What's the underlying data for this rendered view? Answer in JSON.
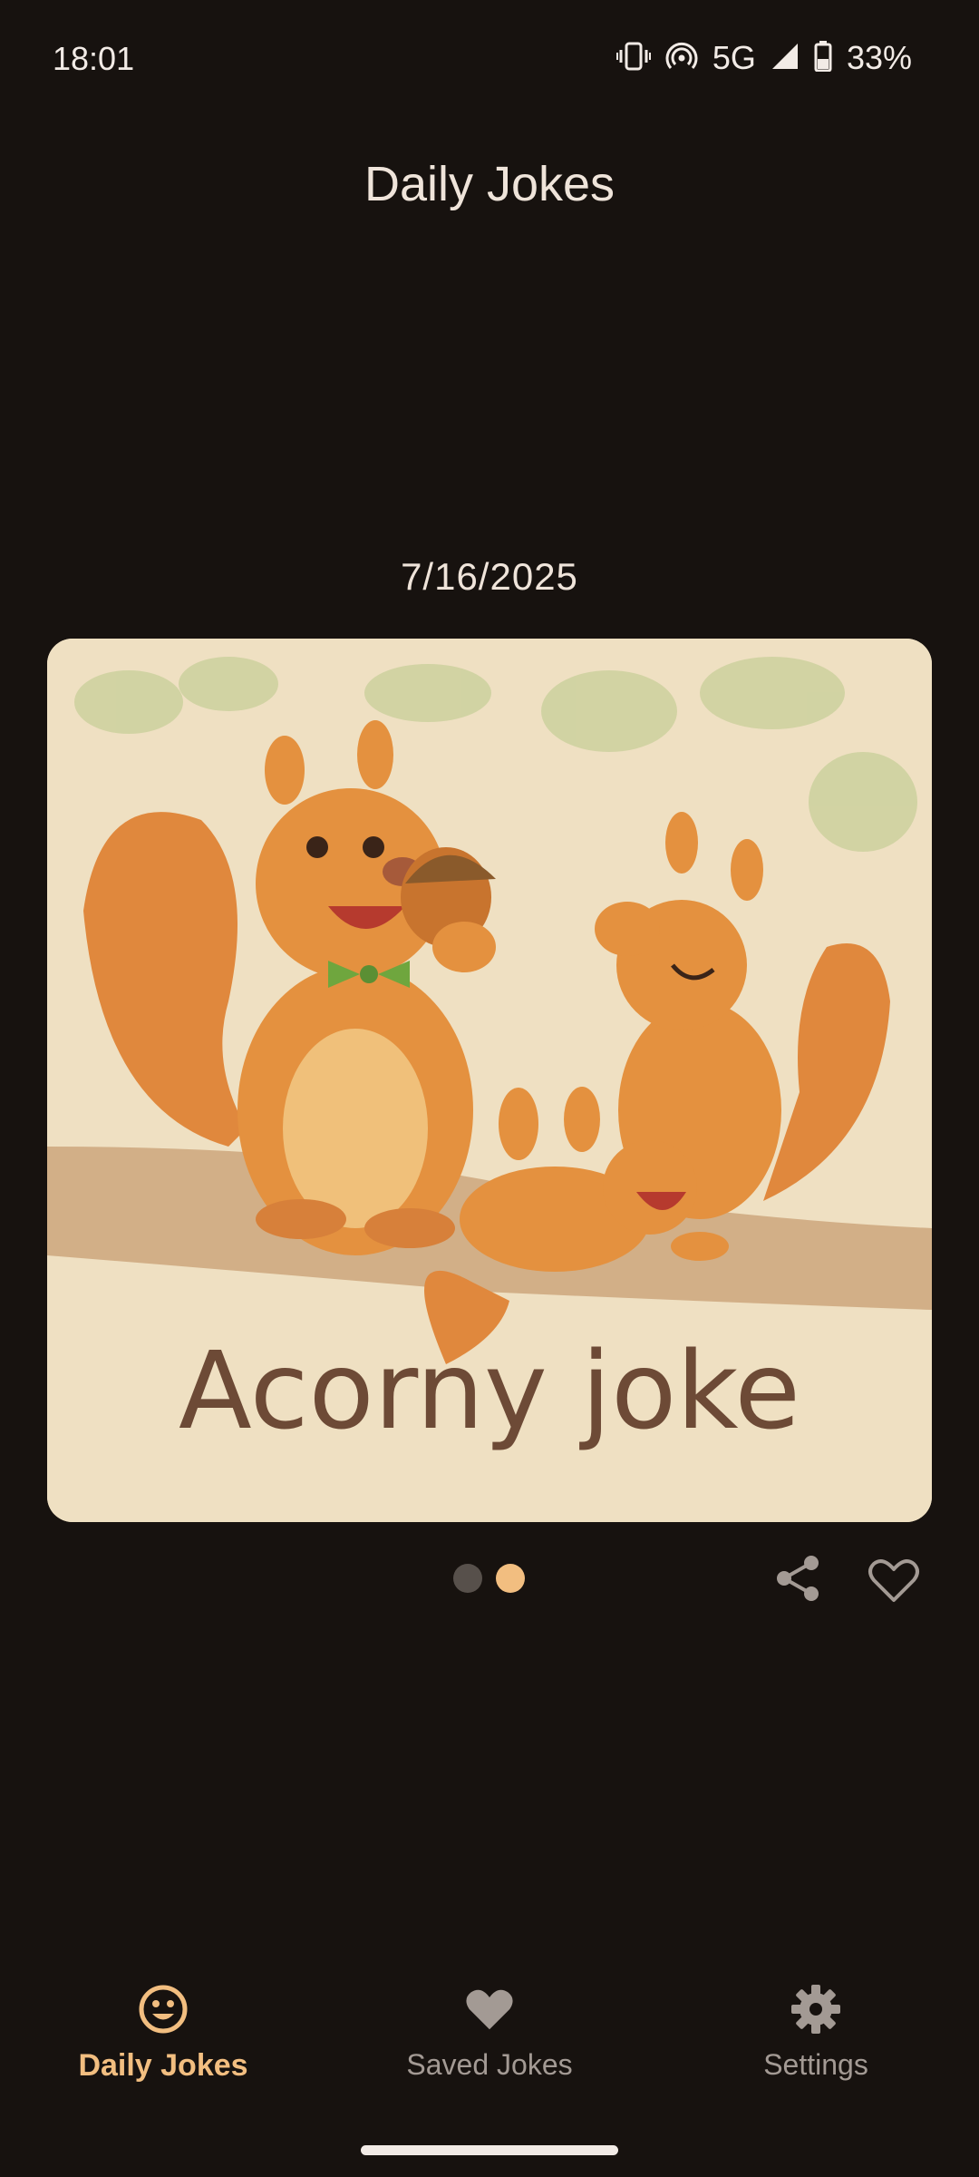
{
  "status_bar": {
    "time": "18:01",
    "network": "5G",
    "battery": "33%",
    "icons": [
      "vibrate-icon",
      "hotspot-icon",
      "signal-icon",
      "battery-icon"
    ]
  },
  "header": {
    "title": "Daily Jokes"
  },
  "joke": {
    "date": "7/16/2025",
    "image_caption": "Acorny joke",
    "page_count": 2,
    "current_page": 2
  },
  "actions": {
    "share_icon": "share-icon",
    "favorite_icon": "heart-outline-icon"
  },
  "bottom_nav": {
    "items": [
      {
        "label": "Daily Jokes",
        "icon": "smiley-icon",
        "active": true
      },
      {
        "label": "Saved Jokes",
        "icon": "heart-icon",
        "active": false
      },
      {
        "label": "Settings",
        "icon": "gear-icon",
        "active": false
      }
    ]
  },
  "colors": {
    "background": "#17120f",
    "accent": "#f2be80",
    "text": "#efe4da",
    "inactive": "#a39a94"
  }
}
